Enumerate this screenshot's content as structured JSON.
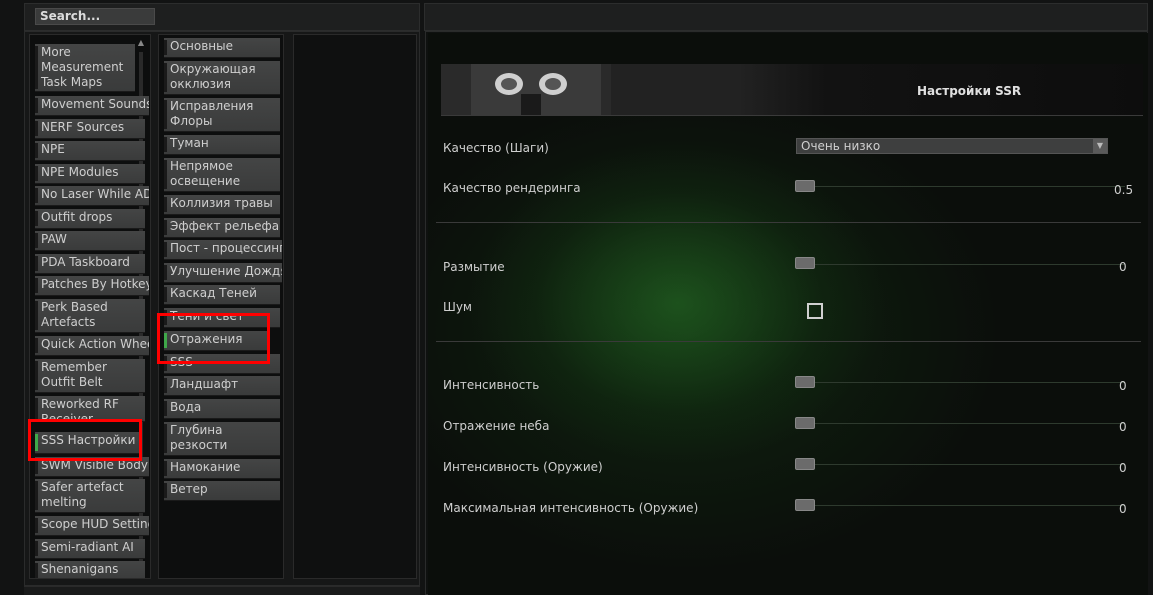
{
  "search": {
    "label": "Search..."
  },
  "mods": [
    {
      "label": "More Measurement Task Maps"
    },
    {
      "label": "Movement Sounds"
    },
    {
      "label": "NERF Sources"
    },
    {
      "label": "NPE"
    },
    {
      "label": "NPE Modules"
    },
    {
      "label": "No Laser While AD"
    },
    {
      "label": "Outfit drops"
    },
    {
      "label": "PAW"
    },
    {
      "label": "PDA Taskboard"
    },
    {
      "label": "Patches By Hotkey"
    },
    {
      "label": "Perk Based Artefacts"
    },
    {
      "label": "Quick Action Whee"
    },
    {
      "label": "Remember Outfit Belt"
    },
    {
      "label": "Reworked RF Receiver"
    },
    {
      "label": "SSS Настройки"
    },
    {
      "label": "SWM Visible Body"
    },
    {
      "label": "Safer artefact melting"
    },
    {
      "label": "Scope HUD Setting"
    },
    {
      "label": "Semi-radiant AI"
    },
    {
      "label": "Shenanigans"
    }
  ],
  "categories": [
    {
      "label": "Основные"
    },
    {
      "label": "Окружающая окклюзия"
    },
    {
      "label": "Исправления Флоры"
    },
    {
      "label": "Туман"
    },
    {
      "label": "Непрямое освещение"
    },
    {
      "label": "Коллизия травы"
    },
    {
      "label": "Эффект рельефа"
    },
    {
      "label": "Пост - процессинг"
    },
    {
      "label": "Улучшение Дождя"
    },
    {
      "label": "Каскад Теней"
    },
    {
      "label": "Тени и свет"
    },
    {
      "label": "Отражения"
    },
    {
      "label": "SSS"
    },
    {
      "label": "Ландшафт"
    },
    {
      "label": "Вода"
    },
    {
      "label": "Глубина резкости оружия"
    },
    {
      "label": "Намокание"
    },
    {
      "label": "Ветер"
    }
  ],
  "settings": {
    "title": "Настройки SSR",
    "quality_label": "Качество (Шаги)",
    "quality_value": "Очень низко",
    "render_quality_label": "Качество рендеринга",
    "render_quality_value": "0.5",
    "blur_label": "Размытие",
    "blur_value": "0",
    "noise_label": "Шум",
    "noise_checked": false,
    "intensity_label": "Интенсивность",
    "intensity_value": "0",
    "sky_reflection_label": "Отражение неба",
    "sky_reflection_value": "0",
    "weapon_intensity_label": "Интенсивность (Оружие)",
    "weapon_intensity_value": "0",
    "max_weapon_intensity_label": "Максимальная интенсивность (Оружие)",
    "max_weapon_intensity_value": "0"
  },
  "colors": {
    "active_marker": "#3fa84a",
    "highlight": "#ff0000"
  }
}
